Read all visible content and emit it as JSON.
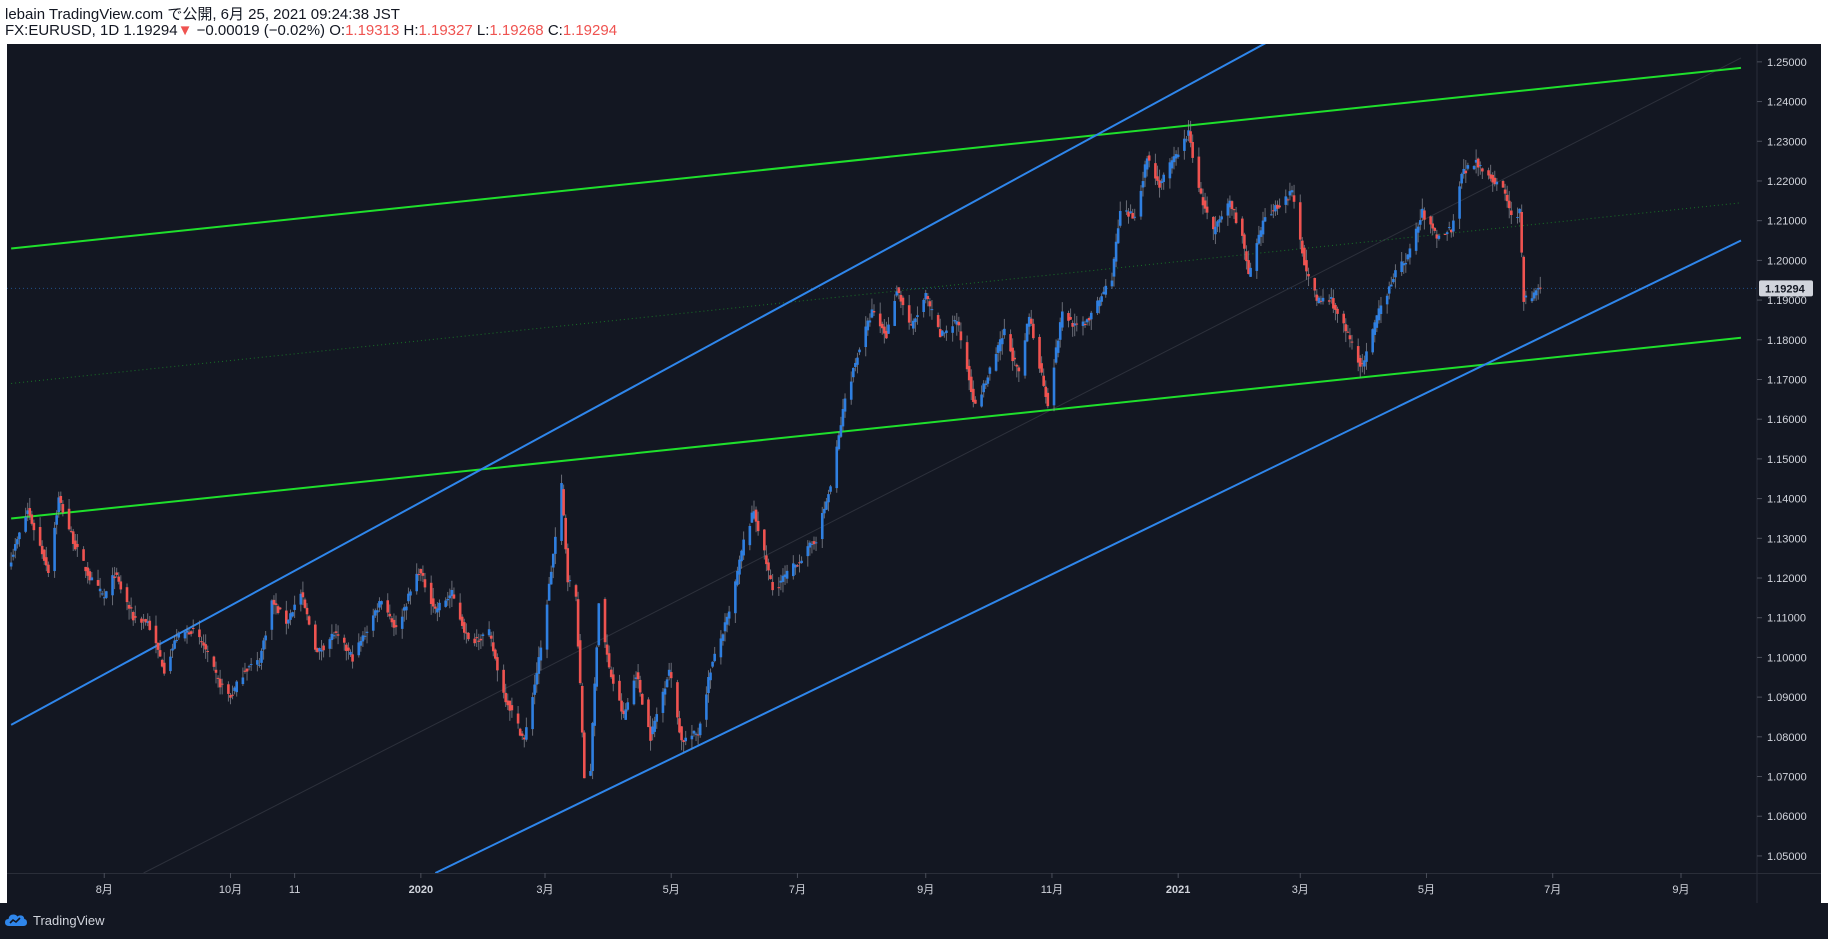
{
  "header": {
    "line1": "lebain TradingView.com で公開, 6月 25, 2021 09:24:38 JST",
    "symbol": "FX:EURUSD, 1D",
    "last": "1.19294",
    "arrow": "▼",
    "change": "−0.00019 (−0.02%)",
    "o_label": "O:",
    "o": "1.19313",
    "h_label": "H:",
    "h": "1.19327",
    "l_label": "L:",
    "l": "1.19268",
    "c_label": "C:",
    "c": "1.19294"
  },
  "footer": {
    "brand": "TradingView"
  },
  "colors": {
    "background": "#131722",
    "up": "#2962ff",
    "up_candle": "#2f7fe0",
    "down": "#ef5350",
    "blue_line": "#2f86eb",
    "green_line": "#1fe02c",
    "axis_text": "#d1d4dc",
    "last_price_label": "#d1d4dc"
  },
  "chart_data": {
    "type": "candlestick",
    "symbol": "FX:EURUSD",
    "interval": "1D",
    "ylim": [
      1.0457,
      1.2545
    ],
    "y_ticks": [
      "1.25000",
      "1.24000",
      "1.23000",
      "1.22000",
      "1.21000",
      "1.20000",
      "1.19000",
      "1.18000",
      "1.17000",
      "1.16000",
      "1.15000",
      "1.14000",
      "1.13000",
      "1.12000",
      "1.11000",
      "1.10000",
      "1.09000",
      "1.08000",
      "1.07000",
      "1.06000",
      "1.05000"
    ],
    "x_ticks": [
      "8月",
      "10月",
      "11",
      "2020",
      "3月",
      "5月",
      "7月",
      "9月",
      "11月",
      "2021",
      "3月",
      "5月",
      "7月",
      "9月"
    ],
    "last_price_label": "1.19294",
    "last_price": 1.19294,
    "date_range": [
      "2019-06-17",
      "2021-06-25"
    ],
    "x_axis_end": "2021-09-30",
    "approx_path": [
      [
        "2019-06-17",
        1.125
      ],
      [
        "2019-06-25",
        1.137
      ],
      [
        "2019-07-01",
        1.128
      ],
      [
        "2019-07-05",
        1.122
      ],
      [
        "2019-07-10",
        1.14
      ],
      [
        "2019-07-18",
        1.128
      ],
      [
        "2019-07-25",
        1.12
      ],
      [
        "2019-08-01",
        1.115
      ],
      [
        "2019-08-06",
        1.121
      ],
      [
        "2019-08-15",
        1.11
      ],
      [
        "2019-08-22",
        1.109
      ],
      [
        "2019-08-30",
        1.097
      ],
      [
        "2019-09-05",
        1.105
      ],
      [
        "2019-09-12",
        1.107
      ],
      [
        "2019-09-18",
        1.103
      ],
      [
        "2019-09-25",
        1.094
      ],
      [
        "2019-10-01",
        1.09
      ],
      [
        "2019-10-08",
        1.097
      ],
      [
        "2019-10-15",
        1.099
      ],
      [
        "2019-10-21",
        1.114
      ],
      [
        "2019-10-28",
        1.109
      ],
      [
        "2019-11-04",
        1.116
      ],
      [
        "2019-11-12",
        1.101
      ],
      [
        "2019-11-20",
        1.106
      ],
      [
        "2019-11-29",
        1.1
      ],
      [
        "2019-12-06",
        1.107
      ],
      [
        "2019-12-13",
        1.115
      ],
      [
        "2019-12-20",
        1.107
      ],
      [
        "2019-12-31",
        1.122
      ],
      [
        "2020-01-08",
        1.112
      ],
      [
        "2020-01-16",
        1.116
      ],
      [
        "2020-01-24",
        1.104
      ],
      [
        "2020-02-03",
        1.106
      ],
      [
        "2020-02-10",
        1.091
      ],
      [
        "2020-02-20",
        1.079
      ],
      [
        "2020-02-28",
        1.102
      ],
      [
        "2020-03-06",
        1.13
      ],
      [
        "2020-03-09",
        1.143
      ],
      [
        "2020-03-12",
        1.12
      ],
      [
        "2020-03-16",
        1.115
      ],
      [
        "2020-03-20",
        1.07
      ],
      [
        "2020-03-23",
        1.072
      ],
      [
        "2020-03-27",
        1.114
      ],
      [
        "2020-04-01",
        1.097
      ],
      [
        "2020-04-08",
        1.085
      ],
      [
        "2020-04-14",
        1.096
      ],
      [
        "2020-04-21",
        1.08
      ],
      [
        "2020-04-30",
        1.097
      ],
      [
        "2020-05-06",
        1.079
      ],
      [
        "2020-05-14",
        1.081
      ],
      [
        "2020-05-20",
        1.097
      ],
      [
        "2020-05-29",
        1.111
      ],
      [
        "2020-06-05",
        1.129
      ],
      [
        "2020-06-10",
        1.137
      ],
      [
        "2020-06-19",
        1.117
      ],
      [
        "2020-06-26",
        1.121
      ],
      [
        "2020-07-03",
        1.125
      ],
      [
        "2020-07-10",
        1.13
      ],
      [
        "2020-07-17",
        1.143
      ],
      [
        "2020-07-24",
        1.165
      ],
      [
        "2020-07-31",
        1.178
      ],
      [
        "2020-08-06",
        1.187
      ],
      [
        "2020-08-13",
        1.181
      ],
      [
        "2020-08-18",
        1.193
      ],
      [
        "2020-08-25",
        1.183
      ],
      [
        "2020-09-01",
        1.191
      ],
      [
        "2020-09-08",
        1.181
      ],
      [
        "2020-09-16",
        1.185
      ],
      [
        "2020-09-25",
        1.163
      ],
      [
        "2020-10-02",
        1.172
      ],
      [
        "2020-10-09",
        1.182
      ],
      [
        "2020-10-16",
        1.171
      ],
      [
        "2020-10-21",
        1.186
      ],
      [
        "2020-10-30",
        1.164
      ],
      [
        "2020-11-06",
        1.187
      ],
      [
        "2020-11-13",
        1.183
      ],
      [
        "2020-11-20",
        1.186
      ],
      [
        "2020-11-30",
        1.196
      ],
      [
        "2020-12-04",
        1.212
      ],
      [
        "2020-12-11",
        1.211
      ],
      [
        "2020-12-17",
        1.226
      ],
      [
        "2020-12-23",
        1.219
      ],
      [
        "2021-01-06",
        1.232
      ],
      [
        "2021-01-12",
        1.216
      ],
      [
        "2021-01-18",
        1.207
      ],
      [
        "2021-01-26",
        1.215
      ],
      [
        "2021-02-01",
        1.206
      ],
      [
        "2021-02-04",
        1.196
      ],
      [
        "2021-02-12",
        1.211
      ],
      [
        "2021-02-25",
        1.217
      ],
      [
        "2021-03-04",
        1.197
      ],
      [
        "2021-03-09",
        1.19
      ],
      [
        "2021-03-16",
        1.19
      ],
      [
        "2021-03-24",
        1.181
      ],
      [
        "2021-03-31",
        1.173
      ],
      [
        "2021-04-08",
        1.187
      ],
      [
        "2021-04-15",
        1.196
      ],
      [
        "2021-04-22",
        1.201
      ],
      [
        "2021-04-29",
        1.212
      ],
      [
        "2021-05-06",
        1.206
      ],
      [
        "2021-05-13",
        1.208
      ],
      [
        "2021-05-18",
        1.222
      ],
      [
        "2021-05-25",
        1.225
      ],
      [
        "2021-06-01",
        1.221
      ],
      [
        "2021-06-08",
        1.217
      ],
      [
        "2021-06-11",
        1.211
      ],
      [
        "2021-06-15",
        1.212
      ],
      [
        "2021-06-17",
        1.19
      ],
      [
        "2021-06-21",
        1.191
      ],
      [
        "2021-06-25",
        1.19294
      ]
    ],
    "trend_lines": [
      {
        "color": "green",
        "points": [
          [
            "2019-06-17",
            1.203
          ],
          [
            "2021-09-30",
            1.2485
          ]
        ]
      },
      {
        "color": "green",
        "points": [
          [
            "2019-06-17",
            1.135
          ],
          [
            "2021-09-30",
            1.1805
          ]
        ]
      },
      {
        "color": "green_dotted",
        "points": [
          [
            "2019-06-17",
            1.169
          ],
          [
            "2021-09-30",
            1.2145
          ]
        ]
      },
      {
        "color": "blue",
        "points": [
          [
            "2019-06-17",
            1.083
          ],
          [
            "2021-02-15",
            1.2555
          ]
        ]
      },
      {
        "color": "blue",
        "points": [
          [
            "2020-01-08",
            1.0457
          ],
          [
            "2021-09-30",
            1.205
          ]
        ]
      },
      {
        "color": "gray_thin",
        "points": [
          [
            "2019-08-20",
            1.0457
          ],
          [
            "2021-09-30",
            1.251
          ]
        ]
      }
    ]
  }
}
